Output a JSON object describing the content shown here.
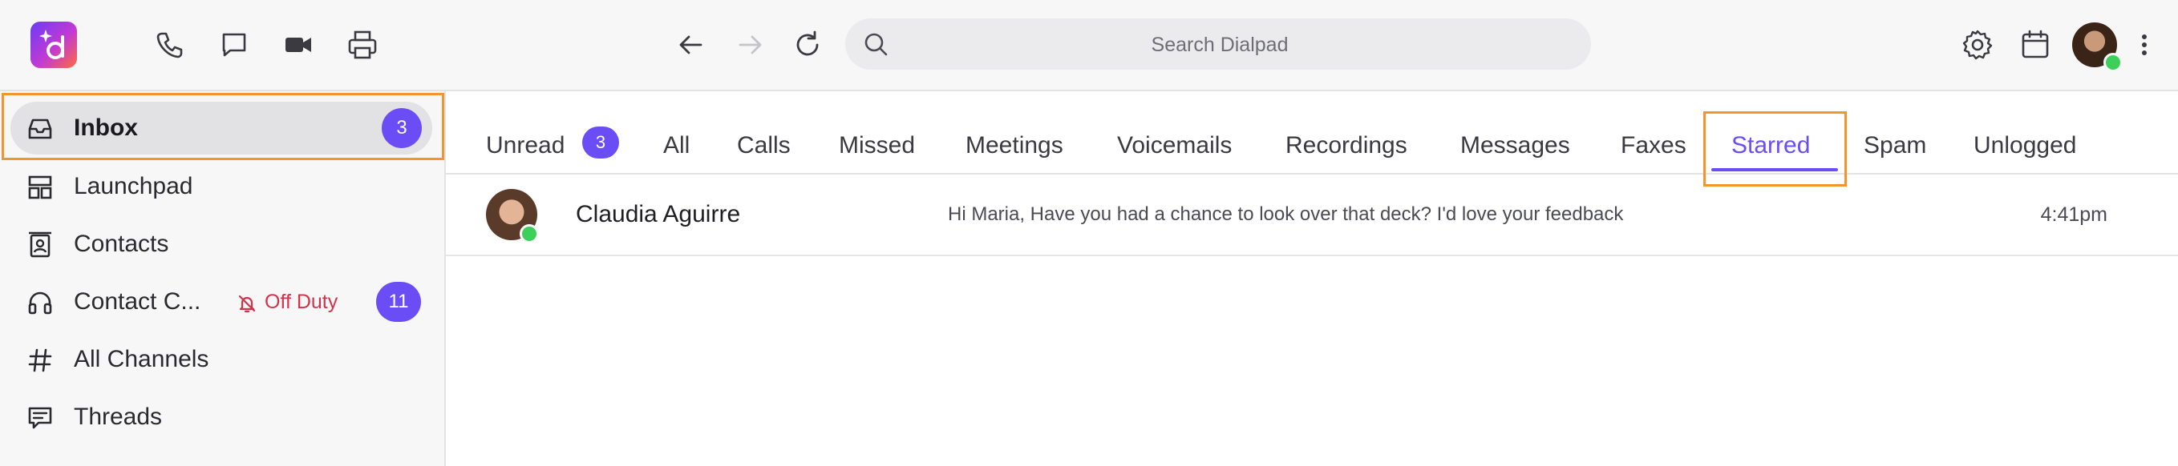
{
  "header": {
    "search_placeholder": "Search Dialpad",
    "icons": [
      "dialpad-logo",
      "phone-icon",
      "chat-icon",
      "video-icon",
      "printer-icon",
      "back-arrow-icon",
      "forward-arrow-icon",
      "refresh-icon",
      "search-icon",
      "gear-icon",
      "calendar-icon",
      "avatar",
      "more-icon"
    ]
  },
  "sidebar": {
    "items": [
      {
        "label": "Inbox",
        "icon": "inbox-icon",
        "badge": "3"
      },
      {
        "label": "Launchpad",
        "icon": "launchpad-icon"
      },
      {
        "label": "Contacts",
        "icon": "contacts-icon"
      },
      {
        "label": "Contact C...",
        "icon": "headset-icon",
        "status": "Off Duty",
        "badge": "11"
      },
      {
        "label": "All Channels",
        "icon": "hash-icon"
      },
      {
        "label": "Threads",
        "icon": "threads-icon"
      }
    ]
  },
  "tabs": {
    "items": [
      "Unread",
      "All",
      "Calls",
      "Missed",
      "Meetings",
      "Voicemails",
      "Recordings",
      "Messages",
      "Faxes",
      "Starred",
      "Spam",
      "Unlogged"
    ],
    "unread_badge": "3",
    "active": "Starred"
  },
  "conversations": [
    {
      "name": "Claudia Aguirre",
      "message": "Hi Maria, Have you had a chance to look over that deck? I'd love your feedback",
      "time": "4:41pm"
    }
  ],
  "colors": {
    "accent": "#6a4df4",
    "highlight_box": "#f0962e",
    "off_duty": "#d0344a",
    "presence": "#3ccf5a"
  }
}
